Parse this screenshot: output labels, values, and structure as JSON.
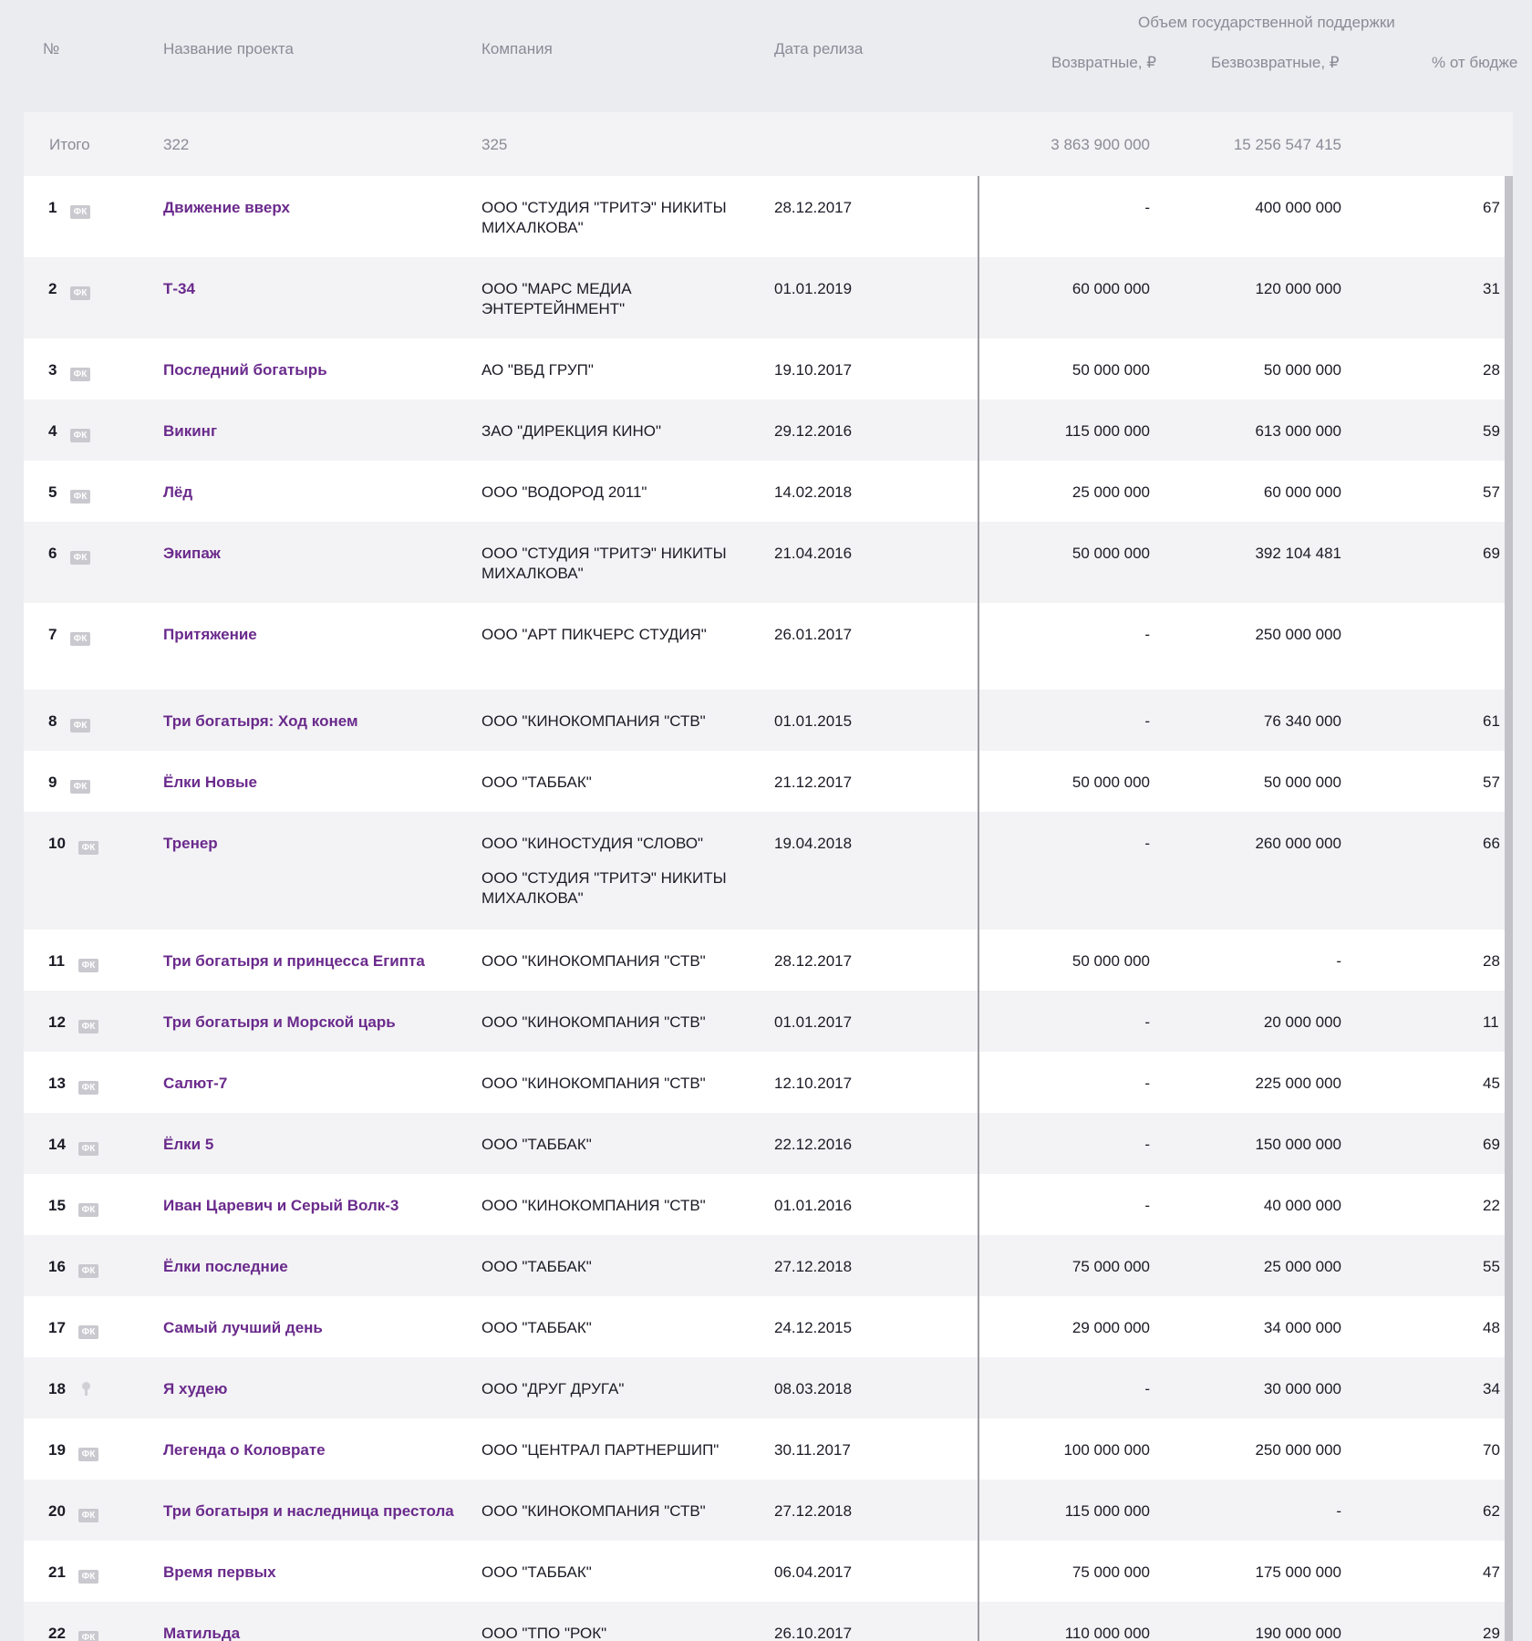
{
  "header": {
    "num": "№",
    "name": "Название проекта",
    "company": "Компания",
    "date": "Дата релиза",
    "support_group": "Объем государственной поддержки",
    "returnable": "Возвратные, ₽",
    "nonreturnable": "Безвозвратные, ₽",
    "pct_budget": "% от бюдже"
  },
  "total": {
    "label": "Итого",
    "projects": "322",
    "companies": "325",
    "returnable": "3 863 900 000",
    "nonreturnable": "15 256 547 415"
  },
  "rows": [
    {
      "num": "1",
      "badge": "ФК",
      "name": "Движение вверх",
      "company": [
        "ООО \"СТУДИЯ \"ТРИТЭ\" НИКИТЫ",
        "МИХАЛКОВА\""
      ],
      "company2": [],
      "date": "28.12.2017",
      "returnable": "-",
      "nonreturnable": "400 000 000",
      "pct": "67"
    },
    {
      "num": "2",
      "badge": "ФК",
      "name": "Т-34",
      "company": [
        "ООО \"МАРС МЕДИА",
        "ЭНТЕРТЕЙНМЕНТ\""
      ],
      "company2": [],
      "date": "01.01.2019",
      "returnable": "60 000 000",
      "nonreturnable": "120 000 000",
      "pct": "31"
    },
    {
      "num": "3",
      "badge": "ФК",
      "name": "Последний богатырь",
      "company": [
        "АО \"ВБД ГРУП\""
      ],
      "company2": [],
      "date": "19.10.2017",
      "returnable": "50 000 000",
      "nonreturnable": "50 000 000",
      "pct": "28"
    },
    {
      "num": "4",
      "badge": "ФК",
      "name": "Викинг",
      "company": [
        "ЗАО \"ДИРЕКЦИЯ КИНО\""
      ],
      "company2": [],
      "date": "29.12.2016",
      "returnable": "115 000 000",
      "nonreturnable": "613 000 000",
      "pct": "59"
    },
    {
      "num": "5",
      "badge": "ФК",
      "name": "Лёд",
      "company": [
        "ООО \"ВОДОРОД 2011\""
      ],
      "company2": [],
      "date": "14.02.2018",
      "returnable": "25 000 000",
      "nonreturnable": "60 000 000",
      "pct": "57"
    },
    {
      "num": "6",
      "badge": "ФК",
      "name": "Экипаж",
      "company": [
        "ООО \"СТУДИЯ \"ТРИТЭ\" НИКИТЫ",
        "МИХАЛКОВА\""
      ],
      "company2": [],
      "date": "21.04.2016",
      "returnable": "50 000 000",
      "nonreturnable": "392 104 481",
      "pct": "69"
    },
    {
      "num": "7",
      "badge": "ФК",
      "name": "Притяжение",
      "company": [
        "ООО \"АРТ ПИКЧЕРС СТУДИЯ\""
      ],
      "company2": [],
      "date": "26.01.2017",
      "returnable": "-",
      "nonreturnable": "250 000 000",
      "pct": ""
    },
    {
      "num": "8",
      "badge": "ФК",
      "name": "Три богатыря: Ход конем",
      "company": [
        "ООО \"КИНОКОМПАНИЯ \"СТВ\""
      ],
      "company2": [],
      "date": "01.01.2015",
      "returnable": "-",
      "nonreturnable": "76 340 000",
      "pct": "61"
    },
    {
      "num": "9",
      "badge": "ФК",
      "name": "Ёлки Новые",
      "company": [
        "ООО \"ТАББАК\""
      ],
      "company2": [],
      "date": "21.12.2017",
      "returnable": "50 000 000",
      "nonreturnable": "50 000 000",
      "pct": "57"
    },
    {
      "num": "10",
      "badge": "ФК",
      "name": "Тренер",
      "company": [
        "ООО \"КИНОСТУДИЯ \"СЛОВО\""
      ],
      "company2": [
        "ООО \"СТУДИЯ \"ТРИТЭ\" НИКИТЫ",
        "МИХАЛКОВА\""
      ],
      "date": "19.04.2018",
      "returnable": "-",
      "nonreturnable": "260 000 000",
      "pct": "66"
    },
    {
      "num": "11",
      "badge": "ФК",
      "name": "Три богатыря и принцесса Египта",
      "company": [
        "ООО \"КИНОКОМПАНИЯ \"СТВ\""
      ],
      "company2": [],
      "date": "28.12.2017",
      "returnable": "50 000 000",
      "nonreturnable": "-",
      "pct": "28"
    },
    {
      "num": "12",
      "badge": "ФК",
      "name": "Три богатыря и Морской царь",
      "company": [
        "ООО \"КИНОКОМПАНИЯ \"СТВ\""
      ],
      "company2": [],
      "date": "01.01.2017",
      "returnable": "-",
      "nonreturnable": "20 000 000",
      "pct": "11"
    },
    {
      "num": "13",
      "badge": "ФК",
      "name": "Салют-7",
      "company": [
        "ООО \"КИНОКОМПАНИЯ \"СТВ\""
      ],
      "company2": [],
      "date": "12.10.2017",
      "returnable": "-",
      "nonreturnable": "225 000 000",
      "pct": "45"
    },
    {
      "num": "14",
      "badge": "ФК",
      "name": "Ёлки 5",
      "company": [
        "ООО \"ТАББАК\""
      ],
      "company2": [],
      "date": "22.12.2016",
      "returnable": "-",
      "nonreturnable": "150 000 000",
      "pct": "69"
    },
    {
      "num": "15",
      "badge": "ФК",
      "name": "Иван Царевич и Серый Волк-3",
      "company": [
        "ООО \"КИНОКОМПАНИЯ \"СТВ\""
      ],
      "company2": [],
      "date": "01.01.2016",
      "returnable": "-",
      "nonreturnable": "40 000 000",
      "pct": "22"
    },
    {
      "num": "16",
      "badge": "ФК",
      "name": "Ёлки последние",
      "company": [
        "ООО \"ТАББАК\""
      ],
      "company2": [],
      "date": "27.12.2018",
      "returnable": "75 000 000",
      "nonreturnable": "25 000 000",
      "pct": "55"
    },
    {
      "num": "17",
      "badge": "ФК",
      "name": "Самый лучший день",
      "company": [
        "ООО \"ТАББАК\""
      ],
      "company2": [],
      "date": "24.12.2015",
      "returnable": "29 000 000",
      "nonreturnable": "34 000 000",
      "pct": "48"
    },
    {
      "num": "18",
      "badge": "pin",
      "name": "Я худею",
      "company": [
        "ООО \"ДРУГ ДРУГА\""
      ],
      "company2": [],
      "date": "08.03.2018",
      "returnable": "-",
      "nonreturnable": "30 000 000",
      "pct": "34"
    },
    {
      "num": "19",
      "badge": "ФК",
      "name": "Легенда о Коловрате",
      "company": [
        "ООО \"ЦЕНТРАЛ ПАРТНЕРШИП\""
      ],
      "company2": [],
      "date": "30.11.2017",
      "returnable": "100 000 000",
      "nonreturnable": "250 000 000",
      "pct": "70"
    },
    {
      "num": "20",
      "badge": "ФК",
      "name": "Три богатыря и наследница престола",
      "company": [
        "ООО \"КИНОКОМПАНИЯ \"СТВ\""
      ],
      "company2": [],
      "date": "27.12.2018",
      "returnable": "115 000 000",
      "nonreturnable": "-",
      "pct": "62"
    },
    {
      "num": "21",
      "badge": "ФК",
      "name": "Время первых",
      "company": [
        "ООО \"ТАББАК\""
      ],
      "company2": [],
      "date": "06.04.2017",
      "returnable": "75 000 000",
      "nonreturnable": "175 000 000",
      "pct": "47"
    },
    {
      "num": "22",
      "badge": "ФК",
      "name": "Матильда",
      "company": [
        "ООО \"ТПО \"РОК\""
      ],
      "company2": [],
      "date": "26.10.2017",
      "returnable": "110 000 000",
      "nonreturnable": "190 000 000",
      "pct": "29"
    }
  ]
}
